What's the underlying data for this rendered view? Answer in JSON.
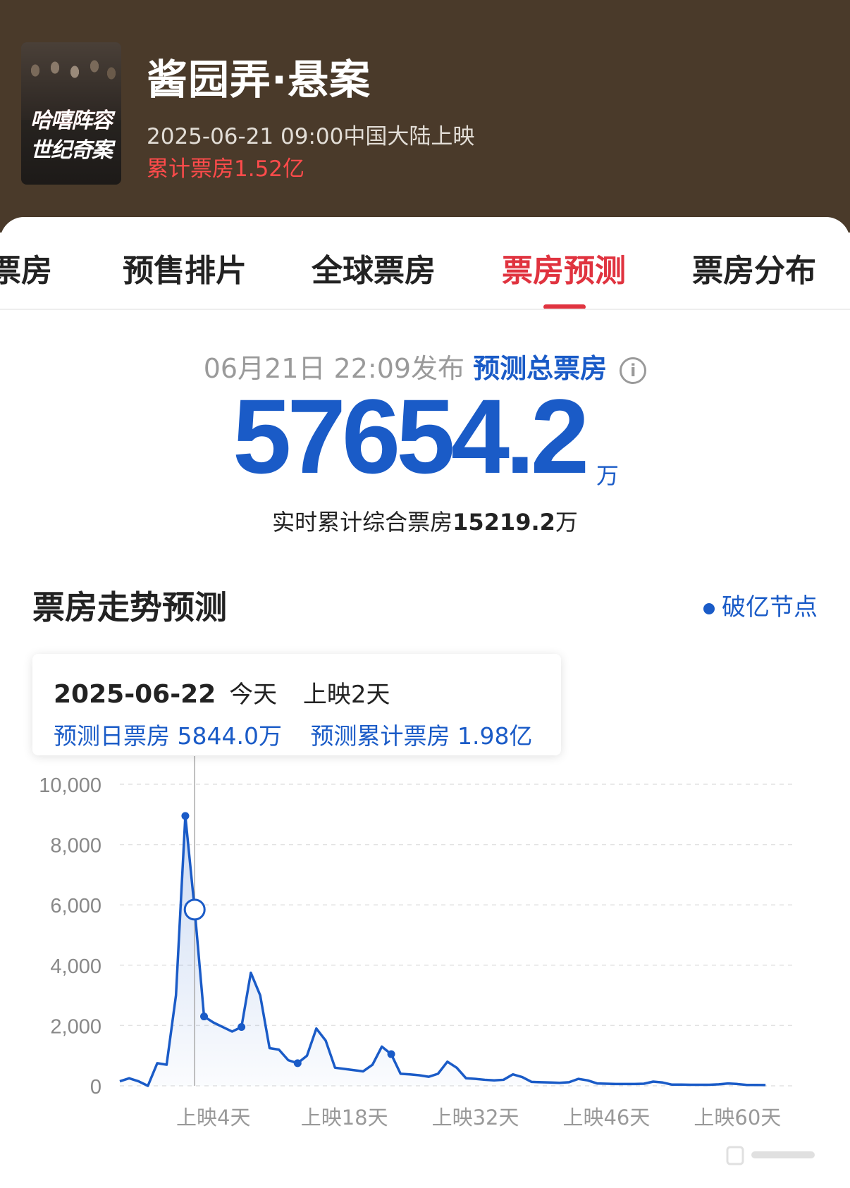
{
  "header": {
    "title": "酱园弄·悬案",
    "release": "2025-06-21 09:00中国大陆上映",
    "gross": "累计票房1.52亿",
    "poster_line1": "哈嘻阵容",
    "poster_line2": "世纪奇案"
  },
  "tabs": [
    {
      "label": "票房",
      "active": false
    },
    {
      "label": "预售排片",
      "active": false
    },
    {
      "label": "全球票房",
      "active": false
    },
    {
      "label": "票房预测",
      "active": true
    },
    {
      "label": "票房分布",
      "active": false
    }
  ],
  "forecast": {
    "published": "06月21日 22:09发布",
    "label": "预测总票房",
    "info_icon": "i",
    "total": "57654.2",
    "unit": "万",
    "realtime_label": "实时累计综合票房",
    "realtime_value": "15219.2",
    "realtime_unit": "万"
  },
  "trend": {
    "title": "票房走势预测",
    "legend": "破亿节点"
  },
  "tooltip": {
    "date": "2025-06-22",
    "today": "今天",
    "days": "上映2天",
    "daily": "预测日票房 5844.0万",
    "cumulative": "预测累计票房 1.98亿"
  },
  "colors": {
    "header_bg": "#4a3a2a",
    "accent_red": "#e0333f",
    "accent_blue": "#1a5bc7",
    "gross_red": "#ff4b4b"
  },
  "chart_data": {
    "type": "area",
    "x_labels": [
      "上映4天",
      "上映18天",
      "上映32天",
      "上映46天",
      "上映60天"
    ],
    "y_ticks": [
      "0",
      "2,000",
      "4,000",
      "6,000",
      "8,000",
      "10,000"
    ],
    "ylim": [
      0,
      10000
    ],
    "xlim": [
      -6,
      66
    ],
    "grid": true,
    "series": [
      {
        "values": [
          [
            -6,
            150
          ],
          [
            -5,
            250
          ],
          [
            -4,
            150
          ],
          [
            -3,
            0
          ],
          [
            -2,
            750
          ],
          [
            -1,
            700
          ],
          [
            0,
            3000
          ],
          [
            1,
            8950
          ],
          [
            2,
            5844
          ],
          [
            3,
            2300
          ],
          [
            4,
            2100
          ],
          [
            5,
            1950
          ],
          [
            6,
            1800
          ],
          [
            7,
            1950
          ],
          [
            8,
            3750
          ],
          [
            9,
            3000
          ],
          [
            10,
            1250
          ],
          [
            11,
            1200
          ],
          [
            12,
            850
          ],
          [
            13,
            750
          ],
          [
            14,
            1000
          ],
          [
            15,
            1900
          ],
          [
            16,
            1500
          ],
          [
            17,
            600
          ],
          [
            18,
            560
          ],
          [
            19,
            520
          ],
          [
            20,
            480
          ],
          [
            21,
            700
          ],
          [
            22,
            1300
          ],
          [
            23,
            1050
          ],
          [
            24,
            400
          ],
          [
            25,
            380
          ],
          [
            26,
            350
          ],
          [
            27,
            300
          ],
          [
            28,
            400
          ],
          [
            29,
            800
          ],
          [
            30,
            600
          ],
          [
            31,
            250
          ],
          [
            32,
            230
          ],
          [
            33,
            200
          ],
          [
            34,
            180
          ],
          [
            35,
            200
          ],
          [
            36,
            380
          ],
          [
            37,
            290
          ],
          [
            38,
            130
          ],
          [
            39,
            120
          ],
          [
            40,
            110
          ],
          [
            41,
            100
          ],
          [
            42,
            120
          ],
          [
            43,
            230
          ],
          [
            44,
            180
          ],
          [
            45,
            80
          ],
          [
            46,
            70
          ],
          [
            47,
            60
          ],
          [
            48,
            60
          ],
          [
            49,
            60
          ],
          [
            50,
            70
          ],
          [
            51,
            140
          ],
          [
            52,
            110
          ],
          [
            53,
            40
          ],
          [
            54,
            40
          ],
          [
            55,
            35
          ],
          [
            56,
            35
          ],
          [
            57,
            35
          ],
          [
            58,
            50
          ],
          [
            59,
            80
          ],
          [
            60,
            60
          ],
          [
            61,
            30
          ],
          [
            62,
            30
          ],
          [
            63,
            25
          ]
        ]
      }
    ],
    "markers": [
      [
        1,
        8950
      ],
      [
        3,
        2300
      ],
      [
        7,
        1950
      ],
      [
        13,
        750
      ],
      [
        23,
        1050
      ]
    ],
    "highlight": [
      2,
      5844
    ]
  }
}
